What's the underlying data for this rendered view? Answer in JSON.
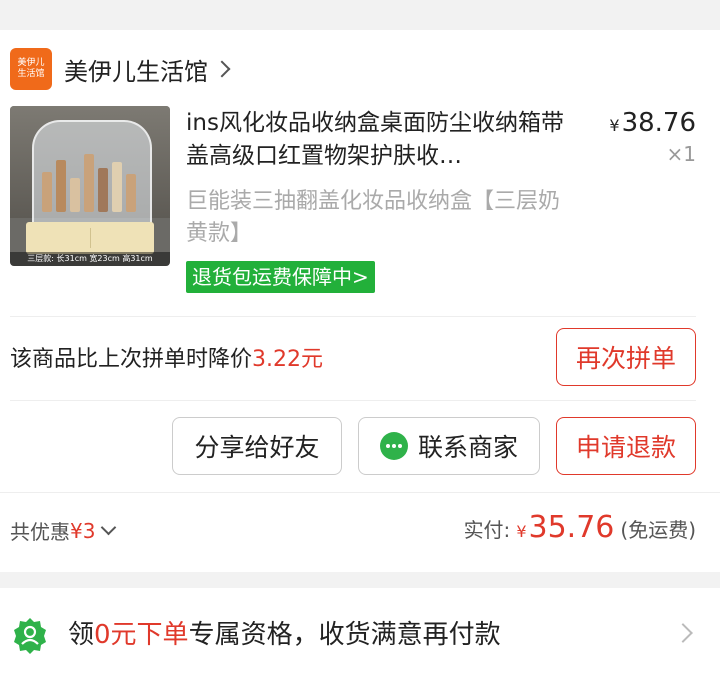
{
  "shop": {
    "logo_line1": "美伊儿",
    "logo_line2": "生活馆",
    "name": "美伊儿生活馆"
  },
  "product": {
    "title": "ins风化妆品收纳盒桌面防尘收纳箱带盖高级口红置物架护肤收…",
    "price_symbol": "¥",
    "price": "38.76",
    "quantity": "×1",
    "sku": "巨能装三抽翻盖化妆品收纳盒【三层奶黄款】",
    "image_caption": "三层款: 长31cm 宽23cm 高31cm",
    "return_badge": "退货包运费保障中>"
  },
  "price_drop": {
    "text": "该商品比上次拼单时降价",
    "amount": "3.22元",
    "button": "再次拼单"
  },
  "actions": {
    "share": "分享给好友",
    "contact": "联系商家",
    "refund": "申请退款"
  },
  "summary": {
    "discount_label": "共优惠",
    "discount_value": "¥3",
    "paid_label": "实付:",
    "paid_symbol": "¥",
    "paid_amount": "35.76",
    "shipping_note": "(免运费)"
  },
  "promo": {
    "prefix": "领",
    "highlight": "0元下单",
    "suffix": "专属资格，收货满意再付款"
  },
  "colors": {
    "accent_red": "#e0392b",
    "shop_orange": "#f06a1a",
    "badge_green": "#22b03a"
  }
}
